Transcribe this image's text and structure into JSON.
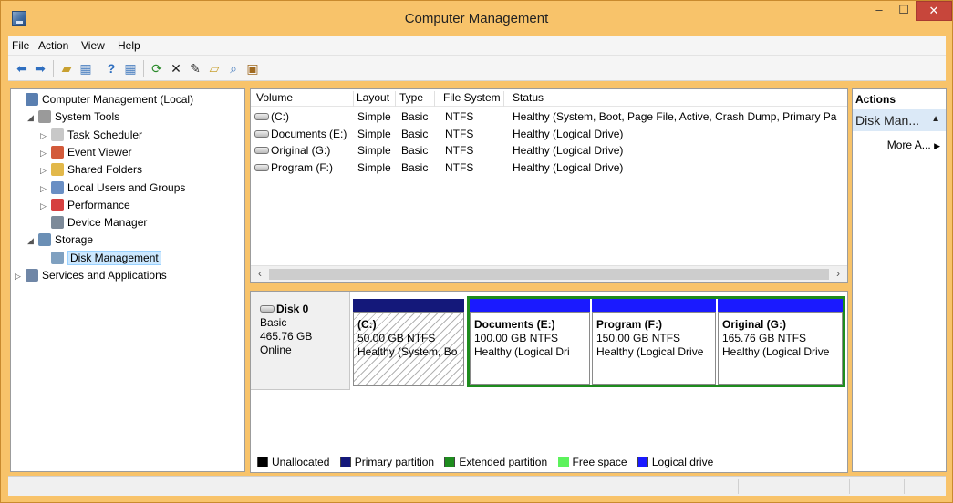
{
  "window": {
    "title": "Computer Management"
  },
  "menu": [
    "File",
    "Action",
    "View",
    "Help"
  ],
  "tree": [
    {
      "label": "Computer Management (Local)",
      "level": 0,
      "expander": "",
      "icon": "computer-management-icon",
      "color": "#5a7fb0"
    },
    {
      "label": "System Tools",
      "level": 1,
      "expander": "◢",
      "icon": "system-tools-icon",
      "color": "#9a9a9a"
    },
    {
      "label": "Task Scheduler",
      "level": 2,
      "expander": "▷",
      "icon": "clock-icon",
      "color": "#c8c8c8"
    },
    {
      "label": "Event Viewer",
      "level": 2,
      "expander": "▷",
      "icon": "event-viewer-icon",
      "color": "#d35a3a"
    },
    {
      "label": "Shared Folders",
      "level": 2,
      "expander": "▷",
      "icon": "shared-folders-icon",
      "color": "#e2b84a"
    },
    {
      "label": "Local Users and Groups",
      "level": 2,
      "expander": "▷",
      "icon": "users-icon",
      "color": "#6a8fc4"
    },
    {
      "label": "Performance",
      "level": 2,
      "expander": "▷",
      "icon": "performance-icon",
      "color": "#d64040"
    },
    {
      "label": "Device Manager",
      "level": 2,
      "expander": "",
      "icon": "device-manager-icon",
      "color": "#7d8a99"
    },
    {
      "label": "Storage",
      "level": 1,
      "expander": "◢",
      "icon": "storage-icon",
      "color": "#6b8fb5"
    },
    {
      "label": "Disk Management",
      "level": 2,
      "expander": "",
      "icon": "disk-management-icon",
      "color": "#7fa0c0",
      "selected": true
    },
    {
      "label": "Services and Applications",
      "level": 0,
      "expander": "▷",
      "icon": "services-icon",
      "color": "#6f86a6"
    }
  ],
  "volumes": {
    "headers": [
      "Volume",
      "Layout",
      "Type",
      "File System",
      "Status"
    ],
    "rows": [
      {
        "volume": "(C:)",
        "layout": "Simple",
        "type": "Basic",
        "fs": "NTFS",
        "status": "Healthy (System, Boot, Page File, Active, Crash Dump, Primary Pa"
      },
      {
        "volume": "Documents (E:)",
        "layout": "Simple",
        "type": "Basic",
        "fs": "NTFS",
        "status": "Healthy (Logical Drive)"
      },
      {
        "volume": "Original (G:)",
        "layout": "Simple",
        "type": "Basic",
        "fs": "NTFS",
        "status": "Healthy (Logical Drive)"
      },
      {
        "volume": "Program (F:)",
        "layout": "Simple",
        "type": "Basic",
        "fs": "NTFS",
        "status": "Healthy (Logical Drive)"
      }
    ]
  },
  "disk": {
    "name": "Disk 0",
    "type": "Basic",
    "size": "465.76 GB",
    "state": "Online",
    "partitions": [
      {
        "name": "(C:)",
        "size": "50.00 GB NTFS",
        "status": "Healthy (System, Bo",
        "kind": "primary"
      },
      {
        "name": "Documents  (E:)",
        "size": "100.00 GB NTFS",
        "status": "Healthy (Logical Dri",
        "kind": "logical"
      },
      {
        "name": "Program  (F:)",
        "size": "150.00 GB NTFS",
        "status": "Healthy (Logical Drive",
        "kind": "logical"
      },
      {
        "name": "Original  (G:)",
        "size": "165.76 GB NTFS",
        "status": "Healthy (Logical Drive",
        "kind": "logical"
      }
    ]
  },
  "legend": [
    {
      "label": "Unallocated",
      "color": "#000000"
    },
    {
      "label": "Primary partition",
      "color": "#14187a"
    },
    {
      "label": "Extended partition",
      "color": "#1e8c1e"
    },
    {
      "label": "Free space",
      "color": "#5cf25c"
    },
    {
      "label": "Logical drive",
      "color": "#1a1aff"
    }
  ],
  "actions": {
    "header": "Actions",
    "section": "Disk Man...",
    "more": "More A..."
  },
  "colors": {
    "primary_bar": "#14187a",
    "logical_bar": "#1a1aff",
    "extended_border": "#1e8c1e",
    "selection": "#cce8ff"
  }
}
